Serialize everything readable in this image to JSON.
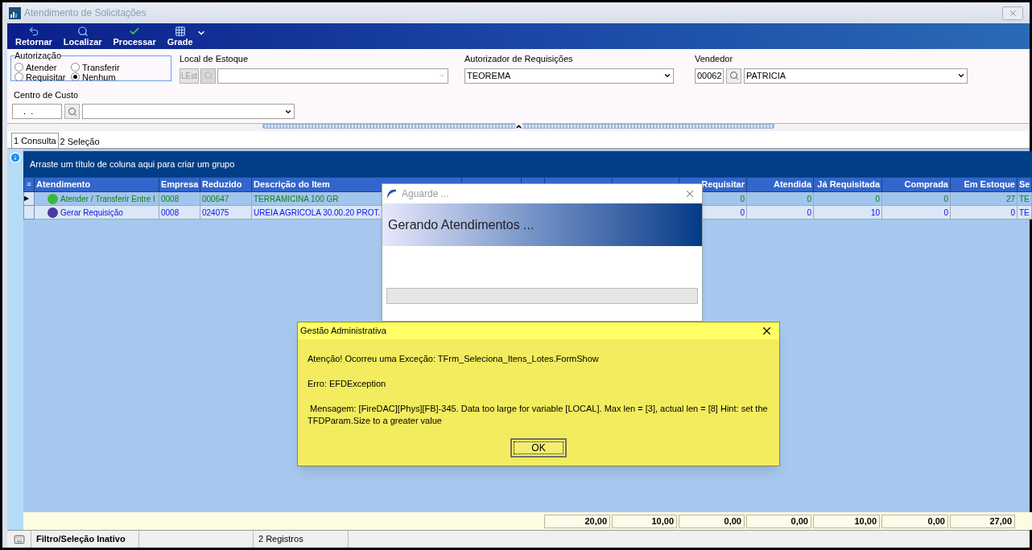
{
  "window": {
    "title": "Atendimento de Solicitações"
  },
  "toolbar": [
    {
      "label": "Retornar"
    },
    {
      "label": "Localizar"
    },
    {
      "label": "Processar"
    },
    {
      "label": "Grade"
    }
  ],
  "autorizacao": {
    "title": "Autorização",
    "options": [
      {
        "label": "Atender",
        "selected": false
      },
      {
        "label": "Transferir",
        "selected": false
      },
      {
        "label": "Requisitar",
        "selected": false
      },
      {
        "label": "Nenhum",
        "selected": true
      }
    ]
  },
  "local_estoque": {
    "label": "Local de Estoque",
    "placeholder": "LEst",
    "disabled": true
  },
  "autorizador": {
    "label": "Autorizador de Requisições",
    "value": "TEOREMA"
  },
  "vendedor": {
    "label": "Vendedor",
    "code": "00062",
    "value": "PATRICIA"
  },
  "centro_custo": {
    "label": "Centro de Custo",
    "code": " .  ."
  },
  "tabs": [
    {
      "label": "1 Consulta",
      "selected": true
    },
    {
      "label": "2 Seleção",
      "selected": false
    }
  ],
  "grid": {
    "group_hint": "Arraste um título de coluna aqui para criar um grupo",
    "options_glyph": "≡",
    "current_marker": "▶",
    "columns": [
      {
        "label": "Atendimento",
        "kind": "text"
      },
      {
        "label": "Empresa",
        "kind": "text"
      },
      {
        "label": "Reduzido",
        "kind": "text"
      },
      {
        "label": "Descrição do Item",
        "kind": "text"
      },
      {
        "label": "Requisitar",
        "kind": "number"
      },
      {
        "label": "Atendida",
        "kind": "number"
      },
      {
        "label": "Já Requisitada",
        "kind": "number"
      },
      {
        "label": "Comprada",
        "kind": "number"
      },
      {
        "label": "Em Estoque",
        "kind": "number"
      },
      {
        "label": "Se",
        "kind": "text"
      }
    ],
    "totals": [
      "20,00",
      "10,00",
      "0,00",
      "0,00",
      "10,00",
      "0,00",
      "27,00"
    ],
    "rows": [
      {
        "current": true,
        "kind": "atender",
        "color": "#3cb83c",
        "cells": [
          "Atender / Transferir Entre I",
          "0008",
          "000647",
          "TERRAMICINA 100 GR",
          "0",
          "0",
          "0",
          "0",
          "27",
          "TE"
        ]
      },
      {
        "current": false,
        "kind": "requisicao",
        "color": "#4a3a9c",
        "cells": [
          "Gerar Requisição",
          "0008",
          "024075",
          "UREIA AGRICOLA 30.00.20 PROT.",
          "0",
          "0",
          "10",
          "0",
          "0",
          "TE"
        ]
      }
    ]
  },
  "status_bar": [
    {
      "text": "Filtro/Seleção Inativo",
      "bold": true
    },
    {
      "text": "2 Registros",
      "bold": false
    }
  ],
  "progress_dialog": {
    "title": "Aguarde ...",
    "heading": "Gerando Atendimentos ...",
    "level": 0
  },
  "error_dialog": {
    "title": "Gestão Administrativa",
    "lines": [
      "Atenção! Ocorreu uma Exceção: TFrm_Seleciona_Itens_Lotes.FormShow",
      "Erro: EFDException",
      " Mensagem: [FireDAC][Phys][FB]-345. Data too large for variable [LOCAL]. Max len = [3], actual len = [8] Hint: set the TFDParam.Size to a greater value"
    ],
    "button": "OK"
  }
}
